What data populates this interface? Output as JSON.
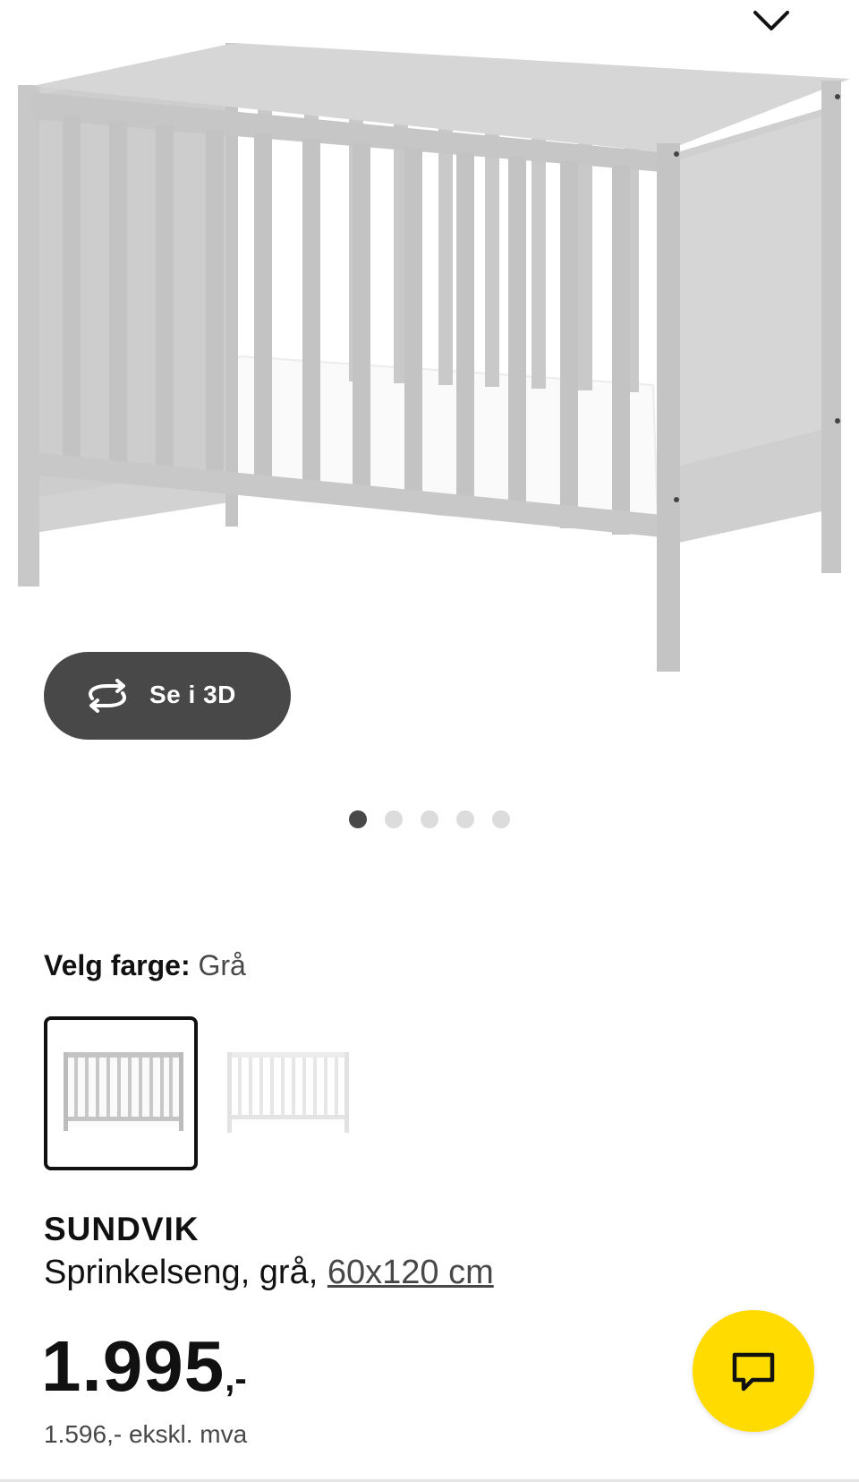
{
  "gallery": {
    "view_3d_label": "Se i 3D",
    "dot_count": 5,
    "active_dot": 1
  },
  "color_picker": {
    "label": "Velg farge:",
    "selected_value": "Grå",
    "options": [
      "grey",
      "white"
    ]
  },
  "product": {
    "name": "SUNDVIK",
    "description_prefix": "Sprinkelseng, grå, ",
    "size_link": "60x120 cm",
    "price_main": "1.995",
    "price_suffix": ",-",
    "price_ex_vat": "1.596,- ekskl. mva"
  },
  "colors": {
    "crib_grey": "#c8c8c8",
    "button_dark": "#484848",
    "chat_yellow": "#ffdb00",
    "dot_inactive": "#dcdcdc"
  }
}
